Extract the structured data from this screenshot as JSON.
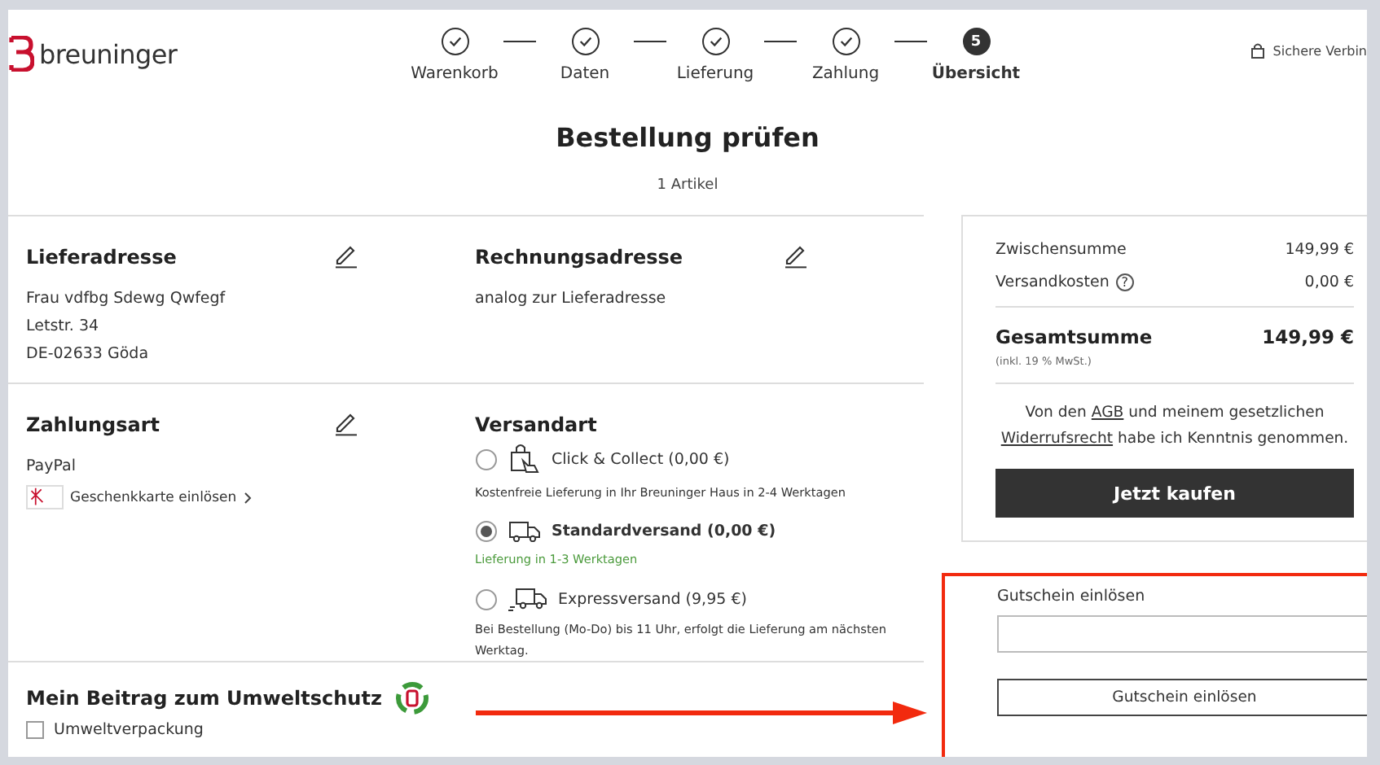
{
  "brand": {
    "name": "breuninger"
  },
  "steps": [
    {
      "label": "Warenkorb",
      "done": true,
      "selected": false
    },
    {
      "label": "Daten",
      "done": true,
      "selected": false
    },
    {
      "label": "Lieferung",
      "done": true,
      "selected": false
    },
    {
      "label": "Zahlung",
      "done": true,
      "selected": false
    },
    {
      "label": "Übersicht",
      "number": "5",
      "done": false,
      "selected": true
    }
  ],
  "secure_connection": "Sichere Verbin",
  "page_title": "Bestellung prüfen",
  "item_count": "1 Artikel",
  "delivery_address": {
    "title": "Lieferadresse",
    "lines": [
      "Frau vdfbg Sdewg Qwfegf",
      "Letstr. 34",
      "DE-02633 Göda"
    ]
  },
  "billing_address": {
    "title": "Rechnungsadresse",
    "lines": [
      "analog zur Lieferadresse"
    ]
  },
  "payment": {
    "title": "Zahlungsart",
    "method": "PayPal",
    "gift_card_link": "Geschenkkarte einlösen"
  },
  "shipping": {
    "title": "Versandart",
    "options": [
      {
        "kind": "bag",
        "label": "Click & Collect (0,00 €)",
        "note": "Kostenfreie Lieferung in Ihr Breuninger Haus in 2-4 Werktagen",
        "selected": false
      },
      {
        "kind": "truck",
        "label": "Standardversand (0,00 €)",
        "note": "Lieferung in 1-3 Werktagen",
        "selected": true
      },
      {
        "kind": "express",
        "label": "Expressversand (9,95 €)",
        "note": "Bei Bestellung (Mo-Do) bis 11 Uhr, erfolgt die Lieferung am nächsten Werktag.",
        "selected": false
      }
    ]
  },
  "environment": {
    "title": "Mein Beitrag zum Umweltschutz",
    "options": [
      {
        "label": "Umweltverpackung",
        "checked": false
      }
    ]
  },
  "summary": {
    "rows": [
      {
        "label": "Zwischensumme",
        "value": "149,99 €"
      },
      {
        "label": "Versandkosten",
        "hint": "?",
        "value": "0,00 €"
      }
    ],
    "total": {
      "label": "Gesamtsumme",
      "value": "149,99 €",
      "note": "(inkl. 19 % MwSt.)"
    },
    "terms": [
      {
        "kind": "text",
        "text": "Von den "
      },
      {
        "kind": "link",
        "text": "AGB"
      },
      {
        "kind": "text",
        "text": " und meinem gesetzlichen "
      },
      {
        "kind": "link",
        "text": "Widerrufsrecht"
      },
      {
        "kind": "text",
        "text": " habe ich Kenntnis genommen."
      }
    ],
    "buy_button": "Jetzt kaufen"
  },
  "coupon": {
    "label": "Gutschein einlösen",
    "button": "Gutschein einlösen"
  }
}
